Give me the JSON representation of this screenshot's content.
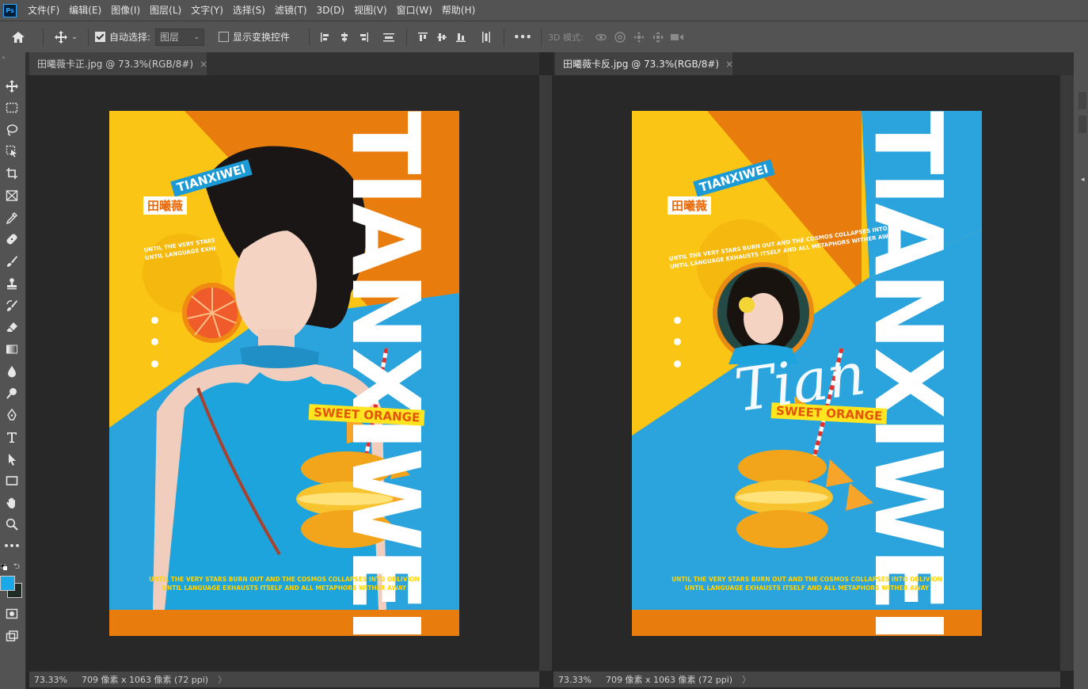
{
  "app": {
    "logo_text": "Ps"
  },
  "menu": [
    "文件(F)",
    "编辑(E)",
    "图像(I)",
    "图层(L)",
    "文字(Y)",
    "选择(S)",
    "滤镜(T)",
    "3D(D)",
    "视图(V)",
    "窗口(W)",
    "帮助(H)"
  ],
  "options": {
    "auto_select_label": "自动选择:",
    "auto_select_checked": true,
    "layer_select_value": "图层",
    "show_transform_label": "显示变换控件",
    "show_transform_checked": false,
    "mode_3d_label": "3D 模式:",
    "more_label": "•••"
  },
  "documents": [
    {
      "tab_title": "田曦薇卡正.jpg @ 73.3%(RGB/8#)",
      "close_label": "×",
      "status_zoom": "73.33%",
      "status_size": "709 像素 x 1063 像素 (72 ppi)",
      "status_arrow": "〉",
      "poster": {
        "vertical_title": "TIANXIWEI",
        "badge_en": "TIANXIWEI",
        "badge_cn": "田曦薇",
        "slogan_top_1": "UNTIL THE VERY STARS BURN OUT AND THE COSMOS COLLAPSES INTO OBLIVION",
        "slogan_top_2": "UNTIL LANGUAGE EXHAUSTS ITSELF AND ALL METAPHORS WITHER AWAY",
        "sweet_label": "SWEET ORANGE",
        "slogan_bottom_1": "UNTIL THE VERY STARS BURN OUT AND THE COSMOS COLLAPSES INTO OBLIVION",
        "slogan_bottom_2": "UNTIL LANGUAGE EXHAUSTS ITSELF AND ALL METAPHORS WITHER AWAY"
      }
    },
    {
      "tab_title": "田曦薇卡反.jpg @ 73.3%(RGB/8#)",
      "close_label": "×",
      "status_zoom": "73.33%",
      "status_size": "709 像素 x 1063 像素 (72 ppi)",
      "status_arrow": "〉",
      "poster": {
        "vertical_title": "TIANXIWEI",
        "badge_en": "TIANXIWEI",
        "badge_cn": "田曦薇",
        "slogan_top_1": "UNTIL THE VERY STARS BURN OUT AND THE COSMOS COLLAPSES INTO OBLIVION",
        "slogan_top_2": "UNTIL LANGUAGE EXHAUSTS ITSELF AND ALL METAPHORS WITHER AWAY",
        "sweet_label": "SWEET ORANGE",
        "script_signature": "Tian",
        "slogan_bottom_1": "UNTIL THE VERY STARS BURN OUT AND THE COSMOS COLLAPSES INTO OBLIVION",
        "slogan_bottom_2": "UNTIL LANGUAGE EXHAUSTS ITSELF AND ALL METAPHORS WITHER AWAY"
      }
    }
  ],
  "colors": {
    "poster_yellow": "#fbc515",
    "poster_orange": "#e87d0d",
    "poster_blue": "#2ba3dc",
    "foreground_swatch": "#1aa8e8",
    "background_swatch": "#1f2a24"
  },
  "tools": [
    "move-tool",
    "marquee-tool",
    "lasso-tool",
    "object-select-tool",
    "crop-tool",
    "frame-tool",
    "eyedropper-tool",
    "healing-tool",
    "brush-tool",
    "stamp-tool",
    "history-brush-tool",
    "eraser-tool",
    "gradient-tool",
    "blur-tool",
    "dodge-tool",
    "pen-tool",
    "type-tool",
    "path-select-tool",
    "rectangle-tool",
    "hand-tool",
    "zoom-tool",
    "more-tools"
  ]
}
